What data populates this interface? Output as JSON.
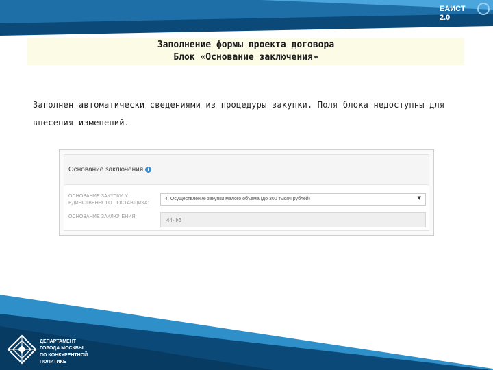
{
  "header": {
    "brand_line1": "ЕАИСТ",
    "brand_line2": "2.0"
  },
  "slide": {
    "title_line1": "Заполнение формы проекта договора",
    "title_line2": "Блок «Основание заключения»",
    "description": "Заполнен автоматически сведениями из процедуры закупки. Поля блока недоступны для внесения изменений."
  },
  "form": {
    "section_title": "Основание заключения",
    "info_icon": "info-icon",
    "basis_label": "ОСНОВАНИЕ ЗАКУПКИ У ЕДИНСТВЕННОГО ПОСТАВЩИКА:",
    "basis_value": "4. Осуществление закупки малого объема (до 300 тысяч рублей)",
    "law_label": "ОСНОВАНИЕ ЗАКЛЮЧЕНИЯ:",
    "law_value": "44-ФЗ"
  },
  "footer": {
    "dept_line1": "ДЕПАРТАМЕНТ",
    "dept_line2": "ГОРОДА МОСКВЫ",
    "dept_line3": "ПО КОНКУРЕНТНОЙ",
    "dept_line4": "ПОЛИТИКЕ"
  },
  "colors": {
    "band_dark": "#0b4a78",
    "band_light": "#2e8fc9",
    "accent": "#3a8bd0"
  }
}
